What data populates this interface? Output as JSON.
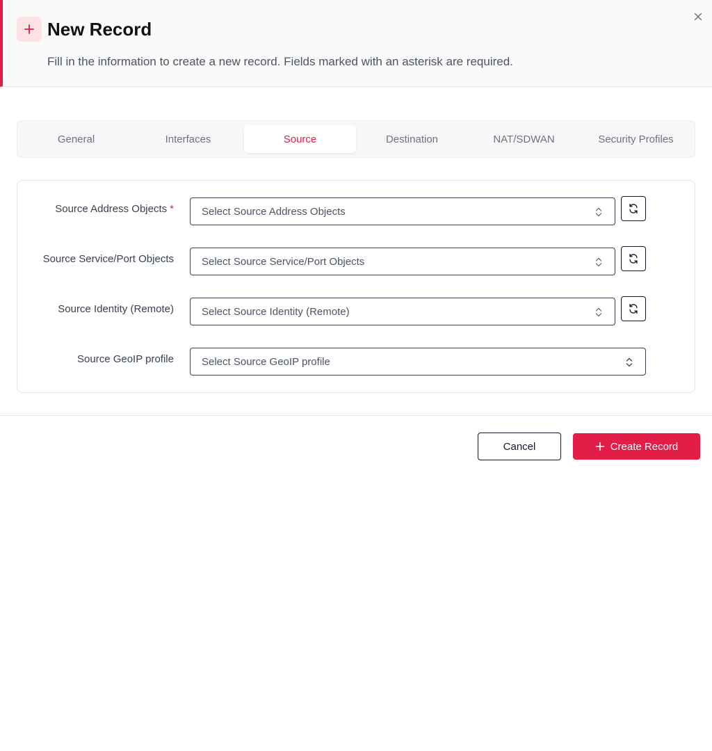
{
  "header": {
    "title": "New Record",
    "subtitle": "Fill in the information to create a new record. Fields marked with an asterisk are required.",
    "icon": "plus-icon",
    "close_icon": "close-icon"
  },
  "tabs": [
    {
      "label": "General",
      "active": false
    },
    {
      "label": "Interfaces",
      "active": false
    },
    {
      "label": "Source",
      "active": true
    },
    {
      "label": "Destination",
      "active": false
    },
    {
      "label": "NAT/SDWAN",
      "active": false
    },
    {
      "label": "Security Profiles",
      "active": false
    }
  ],
  "form": {
    "fields": [
      {
        "label": "Source Address Objects",
        "required": "*",
        "placeholder": "Select Source Address Objects",
        "has_refresh": true
      },
      {
        "label": "Source Service/Port Objects",
        "placeholder": "Select Source Service/Port Objects",
        "has_refresh": true
      },
      {
        "label": "Source Identity (Remote)",
        "placeholder": "Select Source Identity (Remote)",
        "has_refresh": true
      },
      {
        "label": "Source GeoIP profile",
        "placeholder": "Select Source GeoIP profile",
        "has_refresh": false
      }
    ]
  },
  "footer": {
    "cancel_label": "Cancel",
    "create_label": "Create Record"
  },
  "colors": {
    "accent": "#e11d48",
    "accent_light": "#fde2e6",
    "border": "#e5e7eb",
    "text_muted": "#4b5563"
  }
}
